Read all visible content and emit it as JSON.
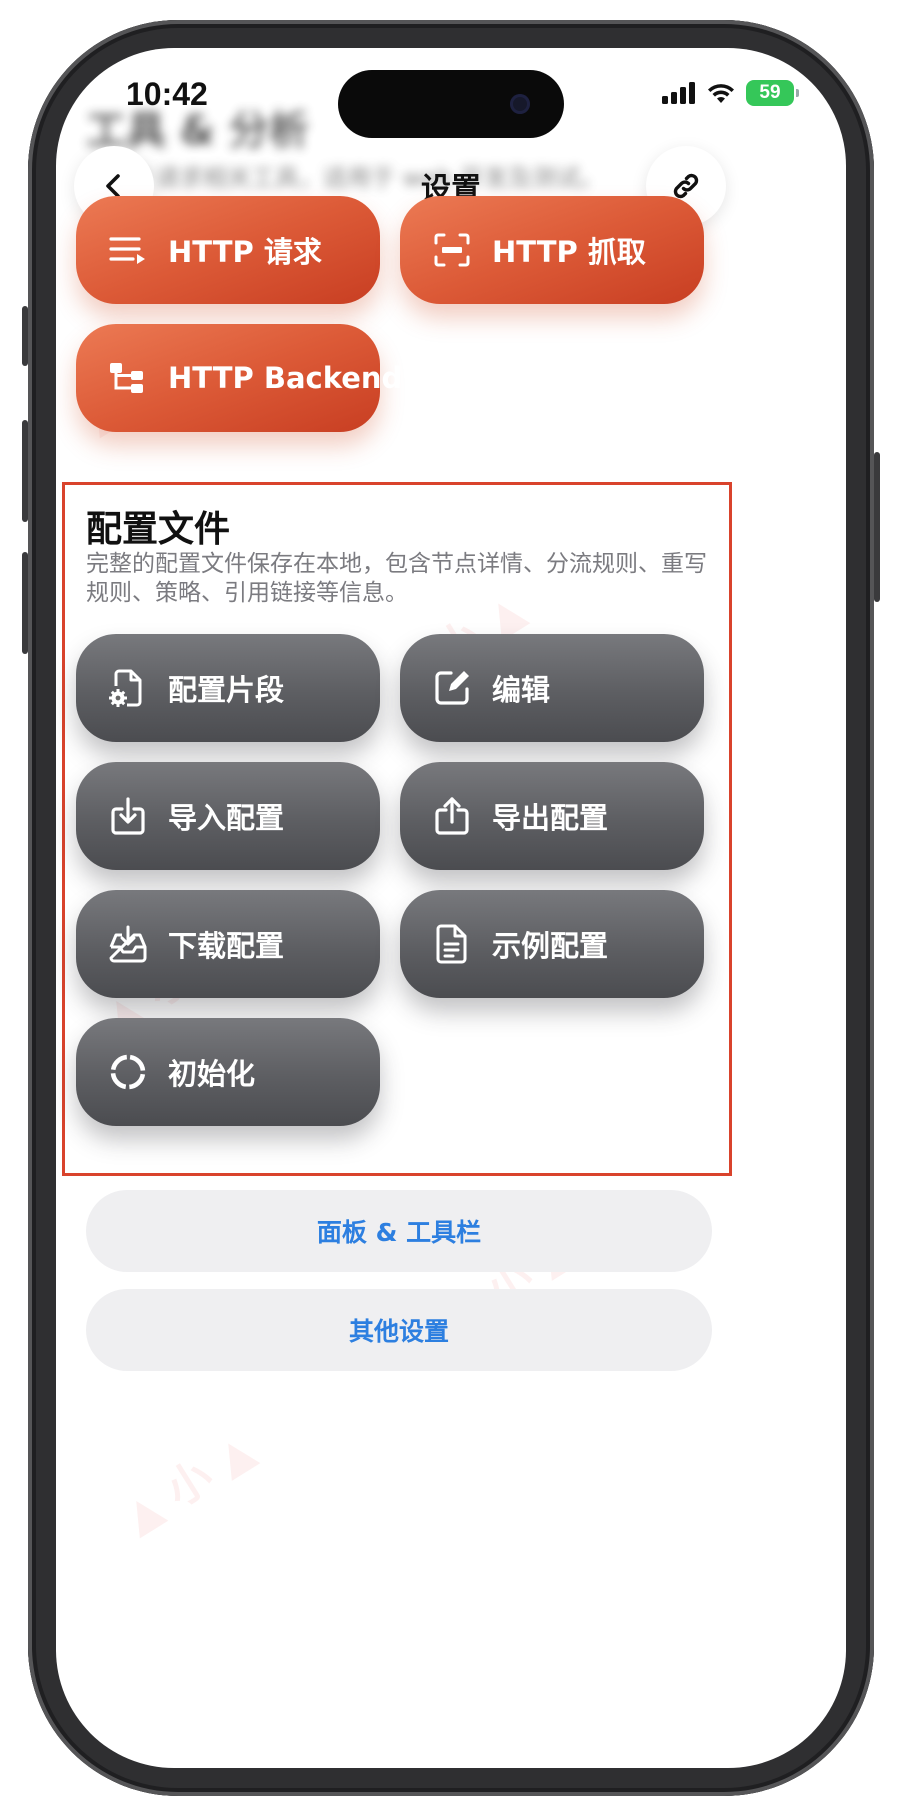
{
  "status_bar": {
    "time": "10:42",
    "battery": "59"
  },
  "background_header": {
    "title": "工具 & 分析",
    "subtitle": "HTTP 请求相关工具，适用于 web 开发及测试。"
  },
  "nav": {
    "title": "设置",
    "back_icon": "chevron-left-icon",
    "link_icon": "link-icon"
  },
  "http_tools": [
    {
      "label": "HTTP 请求",
      "icon": "list-send-icon"
    },
    {
      "label": "HTTP 抓取",
      "icon": "http-capture-icon"
    },
    {
      "label": "HTTP Backend",
      "icon": "tree-nodes-icon"
    }
  ],
  "config_section": {
    "title": "配置文件",
    "description": "完整的配置文件保存在本地，包含节点详情、分流规则、重写规则、策略、引用链接等信息。",
    "buttons": [
      {
        "label": "配置片段",
        "icon": "document-gear-icon"
      },
      {
        "label": "编辑",
        "icon": "edit-square-icon"
      },
      {
        "label": "导入配置",
        "icon": "import-tray-icon"
      },
      {
        "label": "导出配置",
        "icon": "share-upload-icon"
      },
      {
        "label": "下载配置",
        "icon": "download-inbox-icon"
      },
      {
        "label": "示例配置",
        "icon": "text-document-icon"
      },
      {
        "label": "初始化",
        "icon": "reset-dashed-circle-icon"
      }
    ]
  },
  "bottom_links": [
    {
      "label": "面板 & 工具栏"
    },
    {
      "label": "其他设置"
    }
  ],
  "colors": {
    "orange_button": "#dc5a37",
    "gray_button": "#5d5e62",
    "highlight_border": "#d9432c",
    "link_blue": "#2d7fe0",
    "battery_green": "#35c759"
  }
}
